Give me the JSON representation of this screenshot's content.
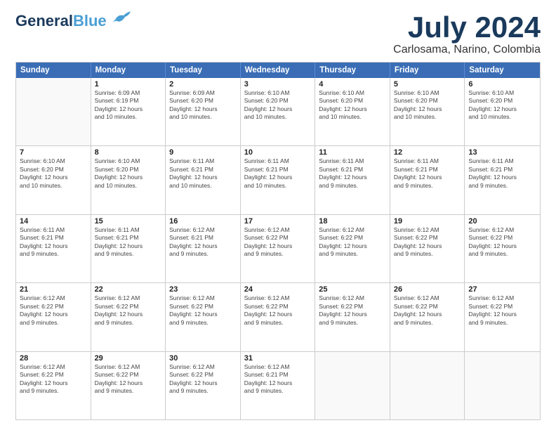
{
  "logo": {
    "line1": "General",
    "line2": "Blue"
  },
  "title": "July 2024",
  "subtitle": "Carlosama, Narino, Colombia",
  "weekdays": [
    "Sunday",
    "Monday",
    "Tuesday",
    "Wednesday",
    "Thursday",
    "Friday",
    "Saturday"
  ],
  "rows": [
    [
      {
        "day": "",
        "info": ""
      },
      {
        "day": "1",
        "info": "Sunrise: 6:09 AM\nSunset: 6:19 PM\nDaylight: 12 hours\nand 10 minutes."
      },
      {
        "day": "2",
        "info": "Sunrise: 6:09 AM\nSunset: 6:20 PM\nDaylight: 12 hours\nand 10 minutes."
      },
      {
        "day": "3",
        "info": "Sunrise: 6:10 AM\nSunset: 6:20 PM\nDaylight: 12 hours\nand 10 minutes."
      },
      {
        "day": "4",
        "info": "Sunrise: 6:10 AM\nSunset: 6:20 PM\nDaylight: 12 hours\nand 10 minutes."
      },
      {
        "day": "5",
        "info": "Sunrise: 6:10 AM\nSunset: 6:20 PM\nDaylight: 12 hours\nand 10 minutes."
      },
      {
        "day": "6",
        "info": "Sunrise: 6:10 AM\nSunset: 6:20 PM\nDaylight: 12 hours\nand 10 minutes."
      }
    ],
    [
      {
        "day": "7",
        "info": "Sunrise: 6:10 AM\nSunset: 6:20 PM\nDaylight: 12 hours\nand 10 minutes."
      },
      {
        "day": "8",
        "info": "Sunrise: 6:10 AM\nSunset: 6:20 PM\nDaylight: 12 hours\nand 10 minutes."
      },
      {
        "day": "9",
        "info": "Sunrise: 6:11 AM\nSunset: 6:21 PM\nDaylight: 12 hours\nand 10 minutes."
      },
      {
        "day": "10",
        "info": "Sunrise: 6:11 AM\nSunset: 6:21 PM\nDaylight: 12 hours\nand 10 minutes."
      },
      {
        "day": "11",
        "info": "Sunrise: 6:11 AM\nSunset: 6:21 PM\nDaylight: 12 hours\nand 9 minutes."
      },
      {
        "day": "12",
        "info": "Sunrise: 6:11 AM\nSunset: 6:21 PM\nDaylight: 12 hours\nand 9 minutes."
      },
      {
        "day": "13",
        "info": "Sunrise: 6:11 AM\nSunset: 6:21 PM\nDaylight: 12 hours\nand 9 minutes."
      }
    ],
    [
      {
        "day": "14",
        "info": "Sunrise: 6:11 AM\nSunset: 6:21 PM\nDaylight: 12 hours\nand 9 minutes."
      },
      {
        "day": "15",
        "info": "Sunrise: 6:11 AM\nSunset: 6:21 PM\nDaylight: 12 hours\nand 9 minutes."
      },
      {
        "day": "16",
        "info": "Sunrise: 6:12 AM\nSunset: 6:21 PM\nDaylight: 12 hours\nand 9 minutes."
      },
      {
        "day": "17",
        "info": "Sunrise: 6:12 AM\nSunset: 6:22 PM\nDaylight: 12 hours\nand 9 minutes."
      },
      {
        "day": "18",
        "info": "Sunrise: 6:12 AM\nSunset: 6:22 PM\nDaylight: 12 hours\nand 9 minutes."
      },
      {
        "day": "19",
        "info": "Sunrise: 6:12 AM\nSunset: 6:22 PM\nDaylight: 12 hours\nand 9 minutes."
      },
      {
        "day": "20",
        "info": "Sunrise: 6:12 AM\nSunset: 6:22 PM\nDaylight: 12 hours\nand 9 minutes."
      }
    ],
    [
      {
        "day": "21",
        "info": "Sunrise: 6:12 AM\nSunset: 6:22 PM\nDaylight: 12 hours\nand 9 minutes."
      },
      {
        "day": "22",
        "info": "Sunrise: 6:12 AM\nSunset: 6:22 PM\nDaylight: 12 hours\nand 9 minutes."
      },
      {
        "day": "23",
        "info": "Sunrise: 6:12 AM\nSunset: 6:22 PM\nDaylight: 12 hours\nand 9 minutes."
      },
      {
        "day": "24",
        "info": "Sunrise: 6:12 AM\nSunset: 6:22 PM\nDaylight: 12 hours\nand 9 minutes."
      },
      {
        "day": "25",
        "info": "Sunrise: 6:12 AM\nSunset: 6:22 PM\nDaylight: 12 hours\nand 9 minutes."
      },
      {
        "day": "26",
        "info": "Sunrise: 6:12 AM\nSunset: 6:22 PM\nDaylight: 12 hours\nand 9 minutes."
      },
      {
        "day": "27",
        "info": "Sunrise: 6:12 AM\nSunset: 6:22 PM\nDaylight: 12 hours\nand 9 minutes."
      }
    ],
    [
      {
        "day": "28",
        "info": "Sunrise: 6:12 AM\nSunset: 6:22 PM\nDaylight: 12 hours\nand 9 minutes."
      },
      {
        "day": "29",
        "info": "Sunrise: 6:12 AM\nSunset: 6:22 PM\nDaylight: 12 hours\nand 9 minutes."
      },
      {
        "day": "30",
        "info": "Sunrise: 6:12 AM\nSunset: 6:22 PM\nDaylight: 12 hours\nand 9 minutes."
      },
      {
        "day": "31",
        "info": "Sunrise: 6:12 AM\nSunset: 6:21 PM\nDaylight: 12 hours\nand 9 minutes."
      },
      {
        "day": "",
        "info": ""
      },
      {
        "day": "",
        "info": ""
      },
      {
        "day": "",
        "info": ""
      }
    ]
  ]
}
